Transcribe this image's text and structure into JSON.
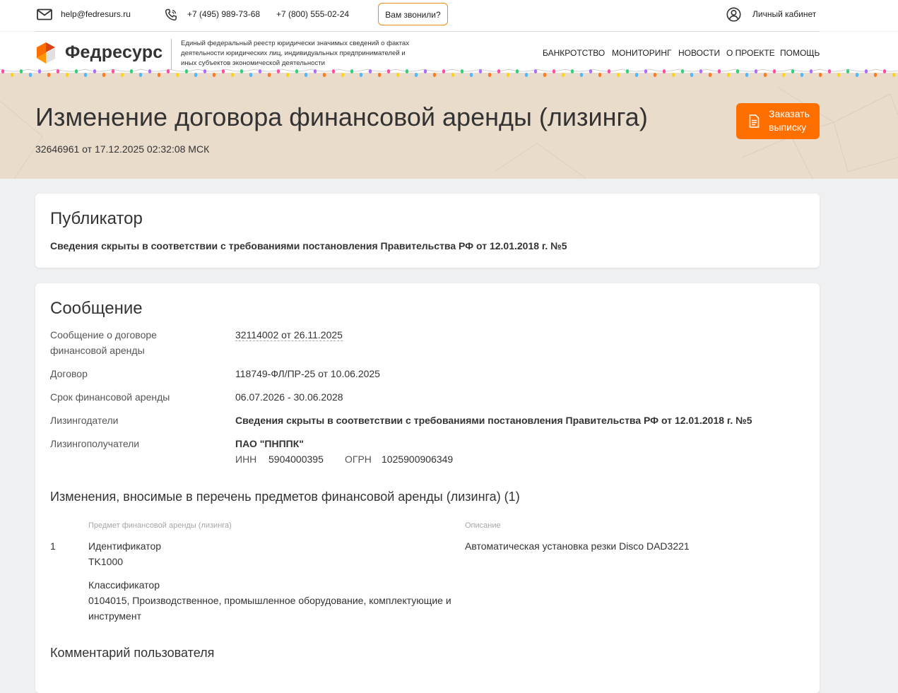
{
  "topbar": {
    "email": "help@fedresurs.ru",
    "phone1": "+7 (495) 989-73-68",
    "phone2": "+7 (800) 555-02-24",
    "call_button": "Вам звонили?",
    "cabinet": "Личный кабинет"
  },
  "header": {
    "logo": "Федресурс",
    "description": "Единый федеральный реестр юридически значимых сведений о фактах деятельности юридических лиц, индивидуальных предпринимателей и иных субъектов экономической деятельности",
    "nav": [
      "БАНКРОТСТВО",
      "МОНИТОРИНГ",
      "НОВОСТИ",
      "О ПРОЕКТЕ",
      "ПОМОЩЬ"
    ]
  },
  "hero": {
    "title": "Изменение договора финансовой аренды (лизинга)",
    "subtitle": "32646961 от 17.12.2025 02:32:08 МСК",
    "order_line1": "Заказать",
    "order_line2": "выписку"
  },
  "publisher": {
    "title": "Публикатор",
    "text": "Сведения скрыты в соответствии с требованиями постановления Правительства РФ от 12.01.2018 г. №5"
  },
  "message": {
    "title": "Сообщение",
    "fields": [
      {
        "label": "Сообщение о договоре финансовой аренды",
        "value": "32114002 от 26.11.2025"
      },
      {
        "label": "Договор",
        "value": "118749-ФЛ/ПР-25 от 10.06.2025"
      },
      {
        "label": "Срок финансовой аренды",
        "value": "06.07.2026 - 30.06.2028"
      },
      {
        "label": "Лизингодатели",
        "value": "Сведения скрыты в соответствии с требованиями постановления Правительства РФ от 12.01.2018 г. №5"
      },
      {
        "label": "Лизингополучатели",
        "value": "ПАО \"ПНППК\""
      }
    ],
    "lessee": {
      "inn_label": "ИНН",
      "inn": "5904000395",
      "ogrn_label": "ОГРН",
      "ogrn": "1025900906349"
    },
    "changes_title": "Изменения, вносимые в перечень предметов финансовой аренды (лизинга) (1)",
    "table": {
      "col_subject": "Предмет финансовой аренды (лизинга)",
      "col_description": "Описание",
      "rows": [
        {
          "num": "1",
          "id_label": "Идентификатор",
          "id_value": "TK1000",
          "class_label": "Классификатор",
          "class_value": "0104015, Производственное, промышленное оборудование, комплектующие и инструмент",
          "description": "Автоматическая установка резки Disco DAD3221"
        }
      ]
    },
    "comment_title": "Комментарий пользователя"
  },
  "colors": {
    "accent": "#ff6f00",
    "hero_bg": "#e9dccb",
    "page_bg": "#eef0f2"
  }
}
